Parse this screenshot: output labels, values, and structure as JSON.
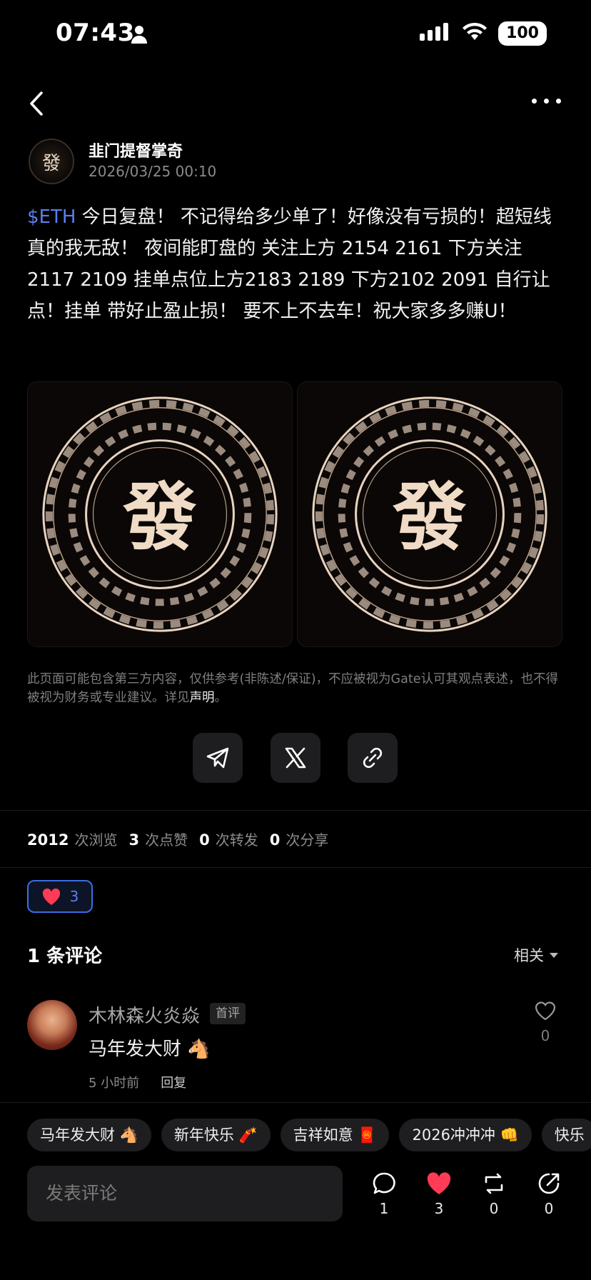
{
  "status_bar": {
    "time": "07:43",
    "battery": "100"
  },
  "post": {
    "author_name": "韭门提督掌奇",
    "timestamp": "2026/03/25 00:10",
    "hashtag": "$ETH",
    "body": " 今日复盘！ 不记得给多少单了！好像没有亏损的！超短线 真的我无敌！ 夜间能盯盘的 关注上方 2154 2161 下方关注 2117 2109 挂单点位上方2183 2189  下方2102 2091 自行让点！挂单 带好止盈止损！ 要不上不去车！祝大家多多赚U！",
    "image_center_char": "發",
    "disclaimer": "此页面可能包含第三方内容，仅供参考(非陈述/保证)，不应被视为Gate认可其观点表述，也不得被视为财务或专业建议。详见",
    "disclaimer_link": "声明",
    "disclaimer_end": "。"
  },
  "stats": {
    "views": "2012",
    "views_label": "次浏览",
    "likes": "3",
    "likes_label": "次点赞",
    "reposts": "0",
    "reposts_label": "次转发",
    "shares": "0",
    "shares_label": "次分享"
  },
  "reaction": {
    "count": "3"
  },
  "comments": {
    "title": "1 条评论",
    "sort_label": "相关",
    "items": [
      {
        "name": "木林森火炎焱",
        "badge": "首评",
        "text": "马年发大财 🐴",
        "time": "5 小时前",
        "reply": "回复",
        "likes": "0"
      }
    ]
  },
  "quick_replies": [
    "马年发大财 🐴",
    "新年快乐 🧨",
    "吉祥如意 🧧",
    "2026冲冲冲 👊",
    "快乐"
  ],
  "composer": {
    "placeholder": "发表评论"
  },
  "bottom_actions": {
    "comments": "1",
    "likes": "3",
    "reposts": "0",
    "shares": "0"
  },
  "colors": {
    "accent": "#3c6de4",
    "hashtag": "#5b7ff0",
    "like_red": "#ff3b55",
    "background": "#000000"
  }
}
